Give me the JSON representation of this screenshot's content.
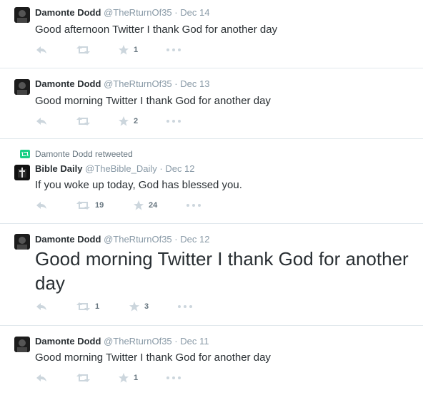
{
  "colors": {
    "text": "#292f33",
    "muted": "#8899a6",
    "divider": "#e1e8ed",
    "icon": "#ccd6dd",
    "retweet_green": "#19cf86"
  },
  "tweets": [
    {
      "name": "Damonte Dodd",
      "handle": "@TheRturnOf35",
      "sep": "·",
      "time": "Dec 14",
      "text": "Good afternoon Twitter I thank God for another day",
      "retweets": "",
      "favorites": "1",
      "avatar": "dark-avatar"
    },
    {
      "name": "Damonte Dodd",
      "handle": "@TheRturnOf35",
      "sep": "·",
      "time": "Dec 13",
      "text": "Good morning Twitter I thank God for another day",
      "retweets": "",
      "favorites": "2",
      "avatar": "dark-avatar"
    },
    {
      "retweeted_by": "Damonte Dodd retweeted",
      "name": "Bible Daily",
      "handle": "@TheBible_Daily",
      "sep": "·",
      "time": "Dec 12",
      "text": "If you woke up today, God has blessed you.",
      "retweets": "19",
      "favorites": "24",
      "avatar": "bible-avatar"
    },
    {
      "name": "Damonte Dodd",
      "handle": "@TheRturnOf35",
      "sep": "·",
      "time": "Dec 12",
      "text": "Good morning Twitter I thank God for another day",
      "retweets": "1",
      "favorites": "3",
      "avatar": "dark-avatar"
    },
    {
      "name": "Damonte Dodd",
      "handle": "@TheRturnOf35",
      "sep": "·",
      "time": "Dec 11",
      "text": "Good morning Twitter I thank God for another day",
      "retweets": "",
      "favorites": "1",
      "avatar": "dark-avatar"
    }
  ],
  "icons": {
    "reply": "reply-icon",
    "retweet": "retweet-icon",
    "favorite": "star-icon",
    "more": "more-icon"
  }
}
